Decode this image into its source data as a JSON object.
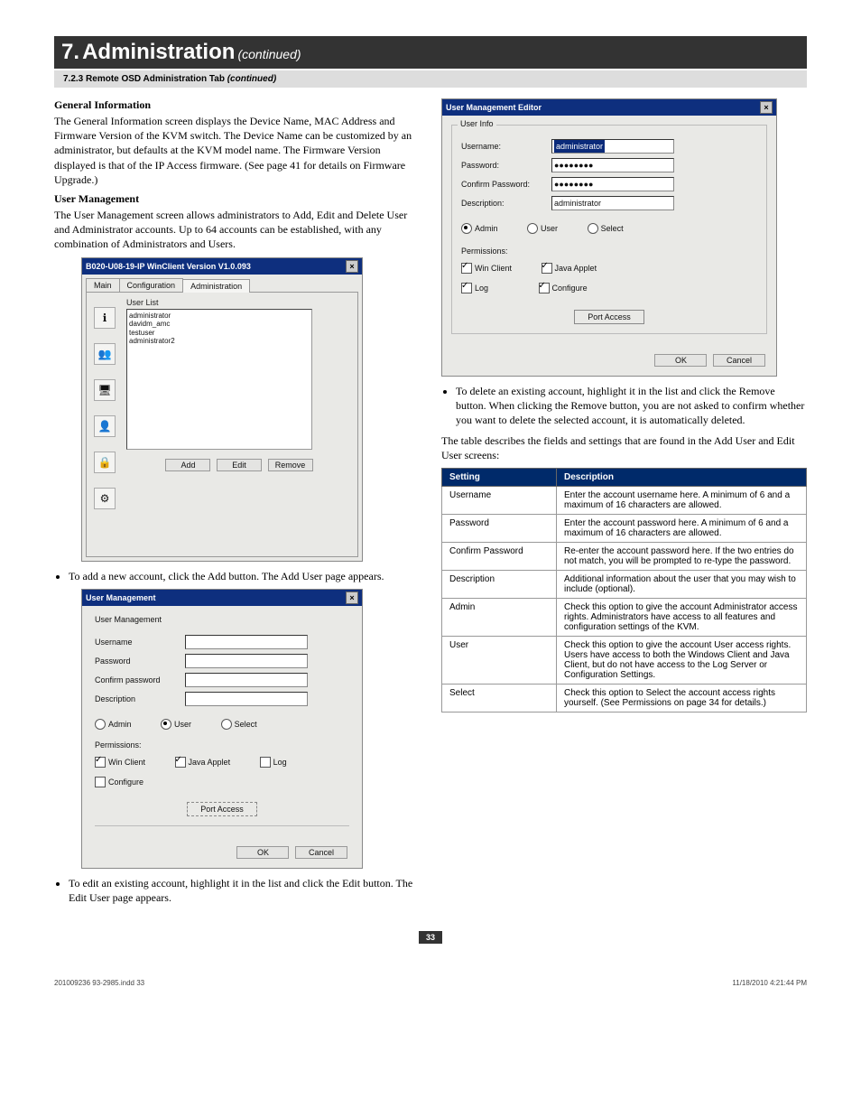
{
  "chapter": {
    "num": "7.",
    "title": "Administration",
    "cont": "(continued)"
  },
  "section": {
    "num": "7.2.3",
    "title": "Remote OSD Administration Tab",
    "cont": "(continued)"
  },
  "left": {
    "gi_head": "General Information",
    "gi_body": "The General Information screen displays the Device Name, MAC Address and Firmware Version of the KVM switch. The Device Name can be customized by an administrator, but defaults at the KVM model name. The Firmware Version displayed is that of the IP Access firmware. (See page 41 for details on Firmware Upgrade.)",
    "um_head": "User Management",
    "um_body": "The User Management screen allows administrators to Add, Edit and Delete User and Administrator accounts. Up to 64 accounts can be established, with any combination of Administrators and Users.",
    "win1_title": "B020-U08-19-IP WinClient Version V1.0.093",
    "tabs": [
      "Main",
      "Configuration",
      "Administration"
    ],
    "userlist_label": "User List",
    "userlist": [
      "administrator",
      "davidm_amc",
      "testuser",
      "administrator2"
    ],
    "btns": {
      "add": "Add",
      "edit": "Edit",
      "remove": "Remove"
    },
    "bullet_add": "To add a new account, click the Add button. The Add User page appears.",
    "win2_title": "User Management",
    "um_label": "User Management",
    "fields": {
      "username": "Username",
      "password": "Password",
      "confirm": "Confirm password",
      "description": "Description"
    },
    "roles": {
      "admin": "Admin",
      "user": "User",
      "select": "Select"
    },
    "perm_label": "Permissions:",
    "perms": {
      "win": "Win Client",
      "java": "Java Applet",
      "log": "Log",
      "configure": "Configure"
    },
    "port_btn": "Port Access",
    "ok": "OK",
    "cancel": "Cancel",
    "bullet_edit": "To edit an existing account, highlight it in the list and click the Edit button. The Edit User page appears."
  },
  "right": {
    "win3_title": "User Management Editor",
    "legend": "User Info",
    "fields": {
      "username": "Username:",
      "password": "Password:",
      "confirm": "Confirm Password:",
      "description": "Description:"
    },
    "vals": {
      "username": "administrator",
      "password": "●●●●●●●●",
      "confirm": "●●●●●●●●",
      "description": "administrator"
    },
    "roles": {
      "admin": "Admin",
      "user": "User",
      "select": "Select"
    },
    "perm_label": "Permissions:",
    "perms": {
      "win": "Win Client",
      "java": "Java Applet",
      "log": "Log",
      "configure": "Configure"
    },
    "port_btn": "Port Access",
    "ok": "OK",
    "cancel": "Cancel",
    "bullet_del": "To delete an existing account, highlight it in the list and click the Remove button. When clicking the Remove button, you are not asked to confirm whether you want to delete the selected account, it is automatically deleted.",
    "table_intro": "The table describes the fields and settings that are found in the Add User and Edit User screens:",
    "table": {
      "head": [
        "Setting",
        "Description"
      ],
      "rows": [
        [
          "Username",
          "Enter the account username here. A minimum of 6 and a maximum of 16 characters are allowed."
        ],
        [
          "Password",
          "Enter the account password here. A minimum of 6 and a maximum of 16 characters are allowed."
        ],
        [
          "Confirm Password",
          "Re-enter the account password here. If the two entries do not match, you will be prompted to re-type the password."
        ],
        [
          "Description",
          "Additional information about the user that you may wish to include (optional)."
        ],
        [
          "Admin",
          "Check this option to give the account Administrator access rights. Administrators have access to all features and configuration settings of the KVM."
        ],
        [
          "User",
          "Check this option to give the account User access rights. Users have access to both the Windows Client and Java Client, but do not have access to the Log Server or Configuration Settings."
        ],
        [
          "Select",
          "Check this option to Select the account access rights yourself. (See Permissions on page 34 for details.)"
        ]
      ]
    }
  },
  "page_num": "33",
  "footer_left": "201009236 93-2985.indd   33",
  "footer_right": "11/18/2010   4:21:44 PM"
}
